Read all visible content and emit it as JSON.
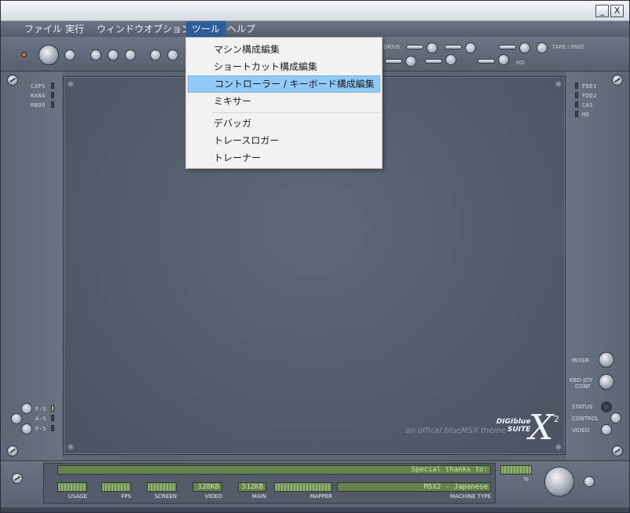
{
  "window": {
    "minimize": "_",
    "close": "X"
  },
  "menubar": [
    "ファイル",
    "実行",
    "ウィンドウ",
    "オプション",
    "ツール",
    "ヘルプ"
  ],
  "tools_menu": {
    "items": [
      "マシン構成編集",
      "ショートカット構成編集",
      "コントローラー / キーボード構成編集",
      "ミキサー",
      "デバッガ",
      "トレースロガー",
      "トレーナー"
    ],
    "highlighted_index": 2
  },
  "toolbar": {
    "drive_label": "DRIVE",
    "tape_label": "TAPE / RWD",
    "hd_label": "HD"
  },
  "left_indicators": [
    "CAPS",
    "KANA",
    "RBOO"
  ],
  "right_indicators": [
    "FDD1",
    "FDD2",
    "CAS",
    "HD"
  ],
  "left_bottom_indicators": [
    "F-S",
    "A-S",
    "P-S"
  ],
  "right_controls": {
    "mixer": "MIXER",
    "kbd_joy": "KBD-JOY",
    "conf": "CONF",
    "status": "STATUS",
    "control": "CONTROL",
    "video": "VIDEO"
  },
  "brand": {
    "name1": "DIGIblue",
    "name2": "SUITE",
    "tagline": "an offical blueMSX theme",
    "x": "X",
    "sup": "2"
  },
  "status": {
    "ticker": "Special thanks to:",
    "machine": "MSX2 - Japanese",
    "video": "128KB",
    "main": "512KB",
    "labels": {
      "usage": "USAGE",
      "fps": "FPS",
      "screen": "SCREEN",
      "video": "VIDEO",
      "main": "MAIN",
      "mapper": "MAPPER",
      "machine_type": "MACHINE TYPE",
      "percent": "%"
    }
  }
}
